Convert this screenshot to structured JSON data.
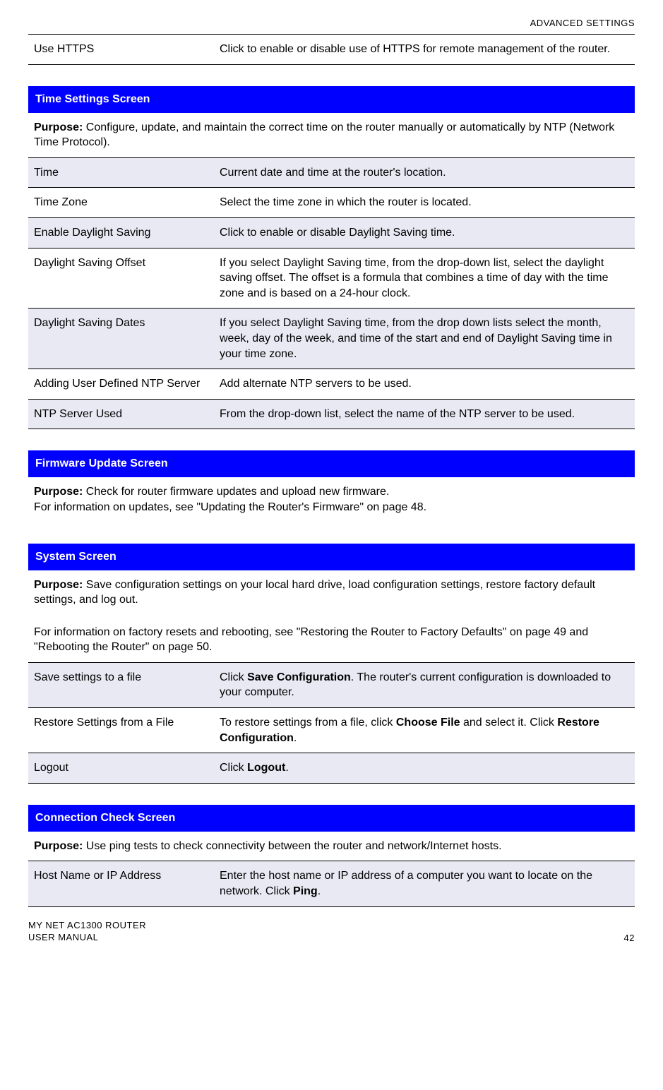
{
  "header": {
    "section": "ADVANCED SETTINGS"
  },
  "https_row": {
    "label": "Use HTTPS",
    "desc": "Click to enable or disable use of HTTPS for remote management of the router."
  },
  "time_section": {
    "title": "Time Settings Screen",
    "purpose_label": "Purpose:",
    "purpose_text": " Configure, update, and maintain the correct time on the router manually or automatically by NTP (Network Time Protocol).",
    "rows": [
      {
        "label": "Time",
        "desc": "Current date and time at the router's location.",
        "shaded": true
      },
      {
        "label": "Time Zone",
        "desc": "Select the time zone in which the router is located.",
        "shaded": false
      },
      {
        "label": "Enable Daylight Saving",
        "desc": "Click to enable or disable Daylight Saving time.",
        "shaded": true
      },
      {
        "label": "Daylight Saving Offset",
        "desc": "If you select Daylight Saving time, from the drop-down list, select the daylight saving offset. The offset is a formula that combines a time of day with the time zone and is based on a 24-hour clock.",
        "shaded": false
      },
      {
        "label": "Daylight Saving Dates",
        "desc": "If you select Daylight Saving time, from the drop down lists select the month, week, day of the week, and time of the start and end of Daylight Saving time in your time zone.",
        "shaded": true
      },
      {
        "label": "Adding User Defined NTP Server",
        "desc": "Add alternate NTP servers to be used.",
        "shaded": false
      },
      {
        "label": "NTP Server Used",
        "desc": "From the drop-down list, select the name of the NTP server to be used.",
        "shaded": true
      }
    ]
  },
  "firmware_section": {
    "title": "Firmware Update Screen",
    "purpose_label": "Purpose:",
    "purpose_text": " Check for router firmware updates and upload new firmware.",
    "extra_line": "For information on updates, see \"Updating the Router's Firmware\" on page 48."
  },
  "system_section": {
    "title": "System Screen",
    "purpose_label": "Purpose:",
    "purpose_text": " Save configuration settings on your local hard drive, load configuration settings, restore factory default settings, and log out.",
    "sub_para": "For information on factory resets and rebooting, see \"Restoring the Router to Factory Defaults\" on page 49 and \"Rebooting the Router\" on page 50.",
    "rows": [
      {
        "label": "Save settings to a file",
        "desc_pre": "Click ",
        "desc_b1": "Save Configuration",
        "desc_post": ". The router's current configuration is downloaded to your computer.",
        "shaded": true
      },
      {
        "label": "Restore Settings from a File",
        "desc_pre": "To restore settings from a file, click ",
        "desc_b1": "Choose File",
        "desc_mid": " and select it. Click ",
        "desc_b2": "Restore Configuration",
        "desc_post": ".",
        "shaded": false
      },
      {
        "label": "Logout",
        "desc_pre": "Click ",
        "desc_b1": "Logout",
        "desc_post": ".",
        "shaded": true
      }
    ]
  },
  "connection_section": {
    "title": "Connection Check Screen",
    "purpose_label": "Purpose:",
    "purpose_text": " Use ping tests to check connectivity between the router and network/Internet hosts.",
    "row": {
      "label": "Host Name or IP Address",
      "desc_pre": "Enter the host name or IP address of a computer you want to locate on the network. Click ",
      "desc_b1": "Ping",
      "desc_post": "."
    }
  },
  "footer": {
    "line1": "MY NET AC1300 ROUTER",
    "line2": "USER MANUAL",
    "page": "42"
  }
}
